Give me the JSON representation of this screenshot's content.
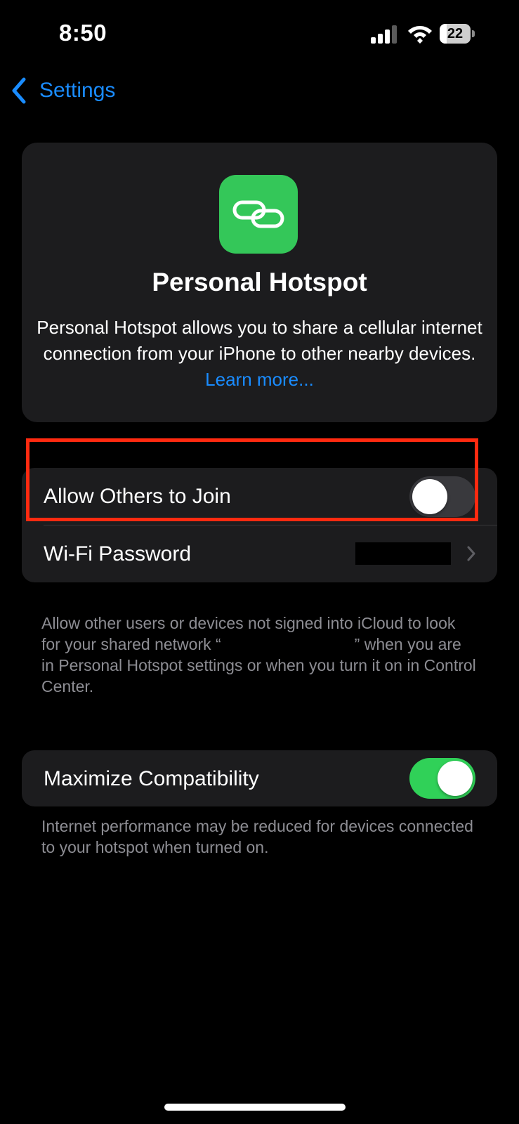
{
  "status_bar": {
    "time": "8:50",
    "battery_level": "22",
    "battery_fraction": 0.22,
    "signal_icon": "cellular-signal-icon",
    "wifi_icon": "wifi-icon"
  },
  "nav": {
    "back_label": "Settings",
    "back_icon": "chevron-left-icon"
  },
  "hero": {
    "icon": "link-chain-icon",
    "icon_color": "#34c759",
    "title": "Personal Hotspot",
    "description": "Personal Hotspot allows you to share a cellular internet connection from your iPhone to other nearby devices.",
    "learn_more": "Learn more..."
  },
  "settings": {
    "allow_others": {
      "label": "Allow Others to Join",
      "enabled": false
    },
    "wifi_password": {
      "label": "Wi-Fi Password"
    },
    "allow_footnote_pre": "Allow other users or devices not signed into iCloud to look for your shared network “",
    "allow_footnote_post": "” when you are in Personal Hotspot settings or when you turn it on in Control Center.",
    "maximize_compat": {
      "label": "Maximize Compatibility",
      "enabled": true
    },
    "maximize_footnote": "Internet performance may be reduced for devices connected to your hotspot when turned on."
  },
  "colors": {
    "accent": "#1a8cff",
    "toggle_on": "#30d158",
    "highlight": "#ff2a10"
  }
}
